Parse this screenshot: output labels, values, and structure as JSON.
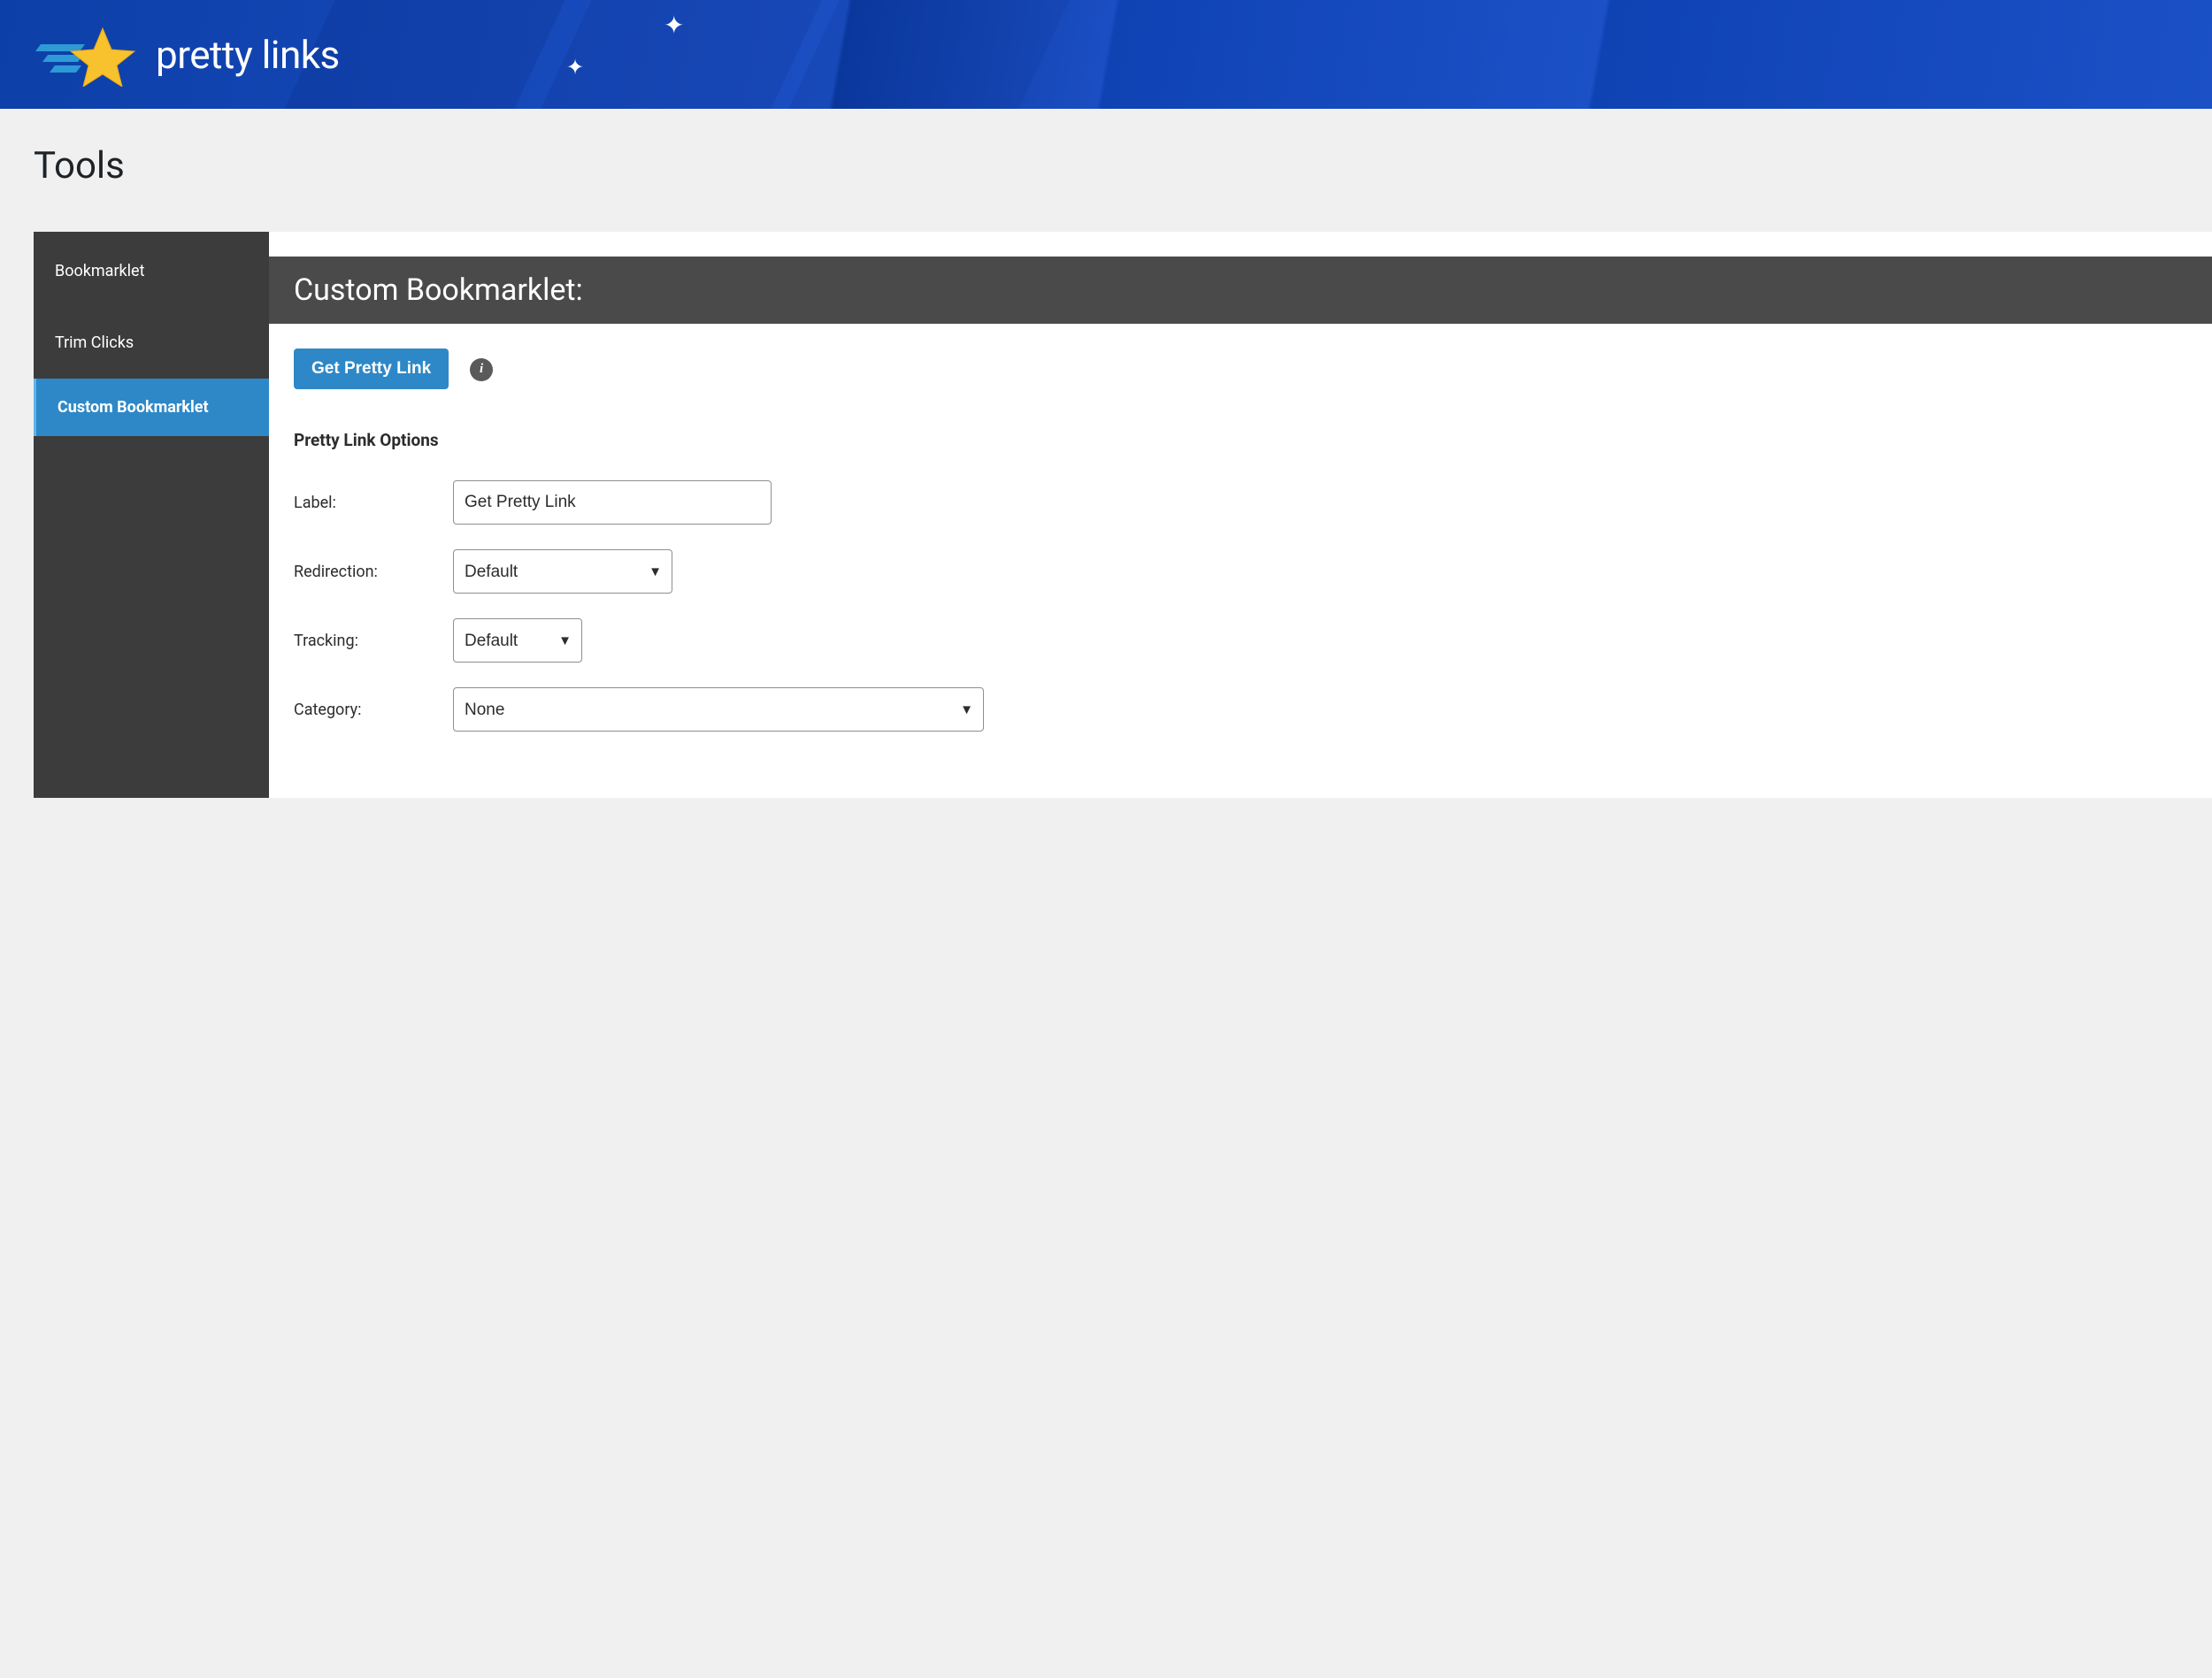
{
  "header": {
    "brand": "pretty links"
  },
  "page": {
    "title": "Tools"
  },
  "sidebar": {
    "items": [
      {
        "label": "Bookmarklet",
        "active": false
      },
      {
        "label": "Trim Clicks",
        "active": false
      },
      {
        "label": "Custom Bookmarklet",
        "active": true
      }
    ]
  },
  "panel": {
    "header": "Custom Bookmarklet:",
    "primary_button": "Get Pretty Link",
    "options_heading": "Pretty Link Options",
    "fields": {
      "label_label": "Label:",
      "label_value": "Get Pretty Link",
      "redirection_label": "Redirection:",
      "redirection_value": "Default",
      "tracking_label": "Tracking:",
      "tracking_value": "Default",
      "category_label": "Category:",
      "category_value": "None"
    }
  }
}
